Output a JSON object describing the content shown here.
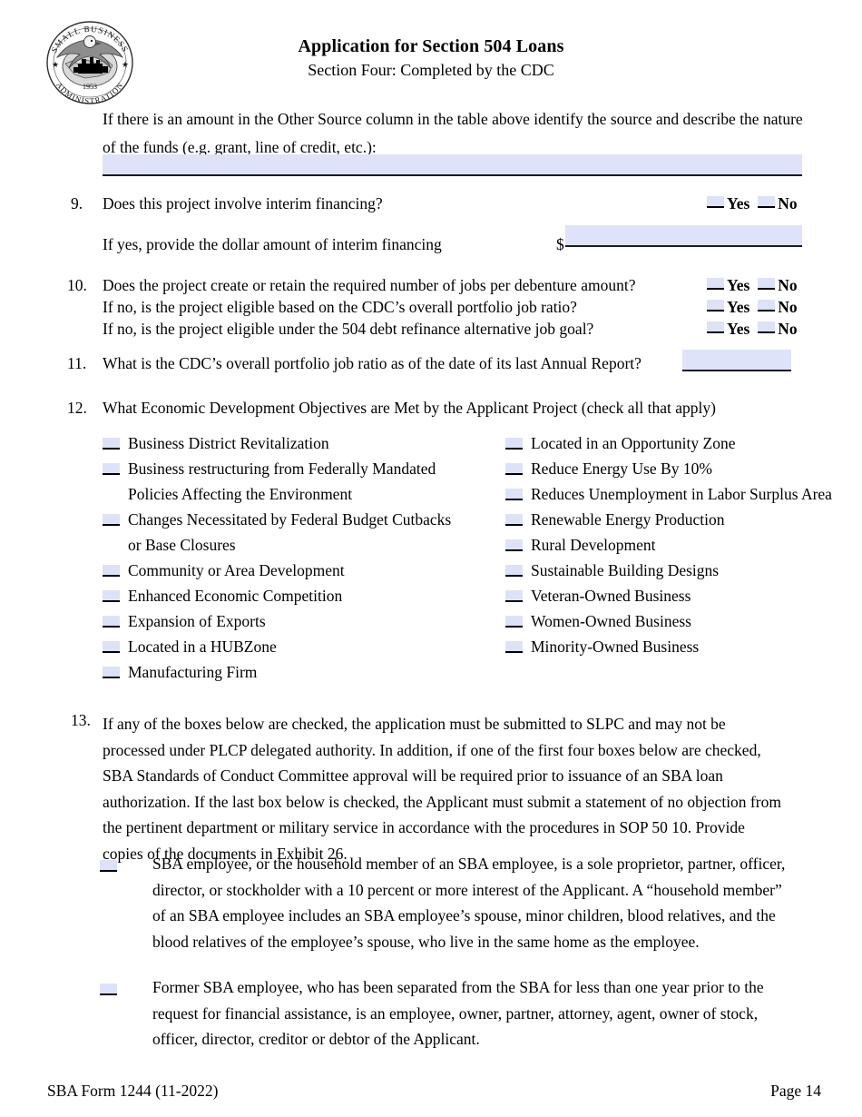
{
  "header": {
    "seal": {
      "top_arc_text": "SMALL BUSINESS",
      "bottom_arc_text": "ADMINISTRATION",
      "year": "1953"
    },
    "title": "Application for Section 504 Loans",
    "subtitle": "Section Four: Completed by the CDC"
  },
  "intro": {
    "text": "If there is an amount in the Other Source column in the table above identify the source and describe the nature of the funds (e.g. grant, line of credit, etc.):",
    "field_value": ""
  },
  "q9": {
    "number": "9.",
    "text": "Does this project involve interim financing?",
    "yes_label": "Yes",
    "no_label": "No",
    "followup_text": "If yes, provide the dollar amount of interim financing",
    "currency_symbol": "$",
    "field_value": ""
  },
  "q10": {
    "number": "10.",
    "lines": [
      "Does the project create or retain the required number of jobs per debenture amount?",
      "If no, is the project eligible based on the CDC’s overall portfolio job ratio?",
      "If no, is the project eligible under the 504 debt refinance alternative job goal?"
    ],
    "yes_label": "Yes",
    "no_label": "No"
  },
  "q11": {
    "number": "11.",
    "text": "What is the CDC’s overall portfolio job ratio as of the date of its last Annual Report?",
    "field_value": ""
  },
  "q12": {
    "number": "12.",
    "text": "What Economic Development Objectives are Met by the Applicant Project (check all that apply)",
    "left_options": [
      "Business District Revitalization",
      "Business restructuring from Federally Mandated Policies Affecting the Environment",
      "Changes Necessitated by Federal Budget Cutbacks or Base Closures",
      "Community or Area Development",
      "Enhanced Economic Competition",
      "Expansion of Exports",
      "Located in a HUBZone",
      "Manufacturing Firm"
    ],
    "right_options": [
      "Located in an Opportunity Zone",
      "Reduce Energy Use By 10%",
      "Reduces Unemployment in Labor Surplus Area",
      "Renewable Energy Production",
      "Rural Development",
      "Sustainable Building Designs",
      "Veteran-Owned Business",
      "Women-Owned Business",
      "Minority-Owned Business"
    ]
  },
  "q13": {
    "number": "13.",
    "text": "If any of the boxes below are checked, the application must be submitted to SLPC and may not be processed under PLCP delegated authority. In addition, if one of the first four boxes below are checked, SBA Standards of Conduct Committee approval will be required prior to issuance of an SBA loan authorization. If the last box below is checked, the Applicant must submit a statement of no objection from the pertinent department or military service in accordance with the procedures in SOP 50 10. Provide copies of the documents in Exhibit 26.",
    "items": [
      "SBA employee, or the household member of an SBA employee, is a sole proprietor, partner, officer, director, or stockholder with a 10 percent or more interest of the Applicant. A “household member” of an SBA employee includes an SBA employee’s spouse, minor children, blood relatives, and the blood relatives of the employee’s spouse, who live in the same home as the employee.",
      "Former SBA employee, who has been separated from the SBA for less than one year prior to the request for financial assistance, is an employee, owner, partner, attorney, agent, owner of stock, officer, director, creditor or debtor of the Applicant."
    ]
  },
  "footer": {
    "form_id": "SBA Form 1244 (11-2022)",
    "page_label": "Page 14"
  },
  "colors": {
    "field_fill": "#dee3fa",
    "checkbox_fill": "#dde2f8",
    "rule": "#1a1a1a"
  }
}
